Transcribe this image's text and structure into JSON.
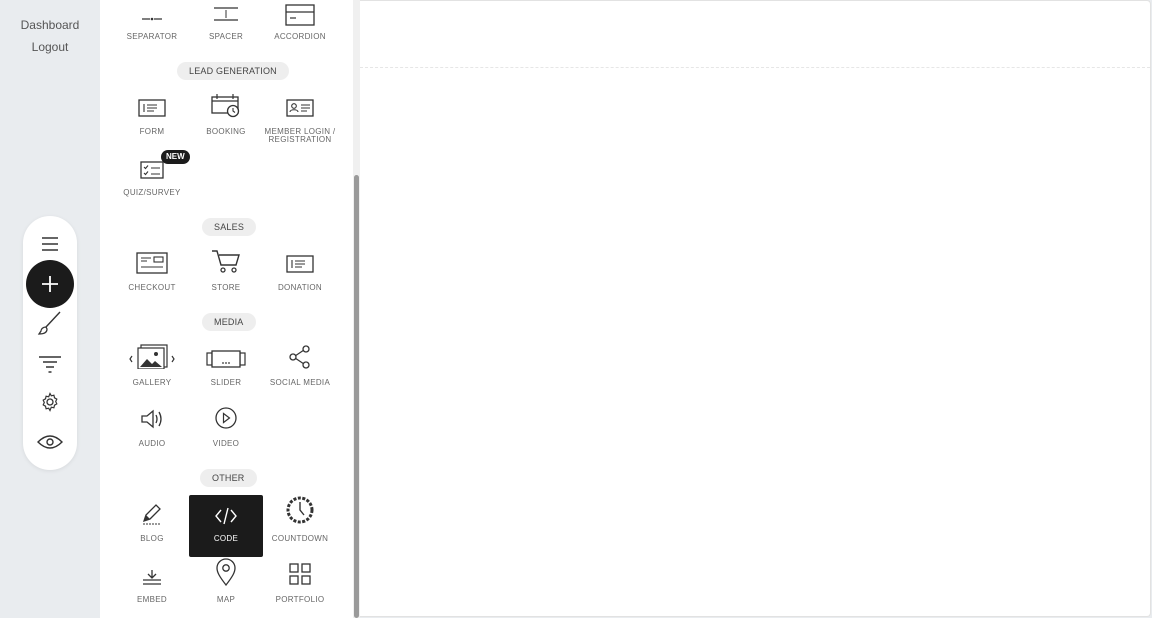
{
  "nav": {
    "dashboard": "Dashboard",
    "logout": "Logout"
  },
  "toolbar": {
    "items": [
      {
        "icon": "menu-icon"
      },
      {
        "icon": "plus-icon"
      },
      {
        "icon": "brush-icon"
      },
      {
        "icon": "filter-icon"
      },
      {
        "icon": "gear-icon"
      },
      {
        "icon": "eye-icon"
      }
    ]
  },
  "panel": {
    "top_row": [
      {
        "label": "SEPARATOR",
        "icon": "separator-icon"
      },
      {
        "label": "SPACER",
        "icon": "spacer-icon"
      },
      {
        "label": "ACCORDION",
        "icon": "accordion-icon"
      }
    ],
    "lead_generation": {
      "title": "LEAD GENERATION",
      "items": [
        {
          "label": "FORM",
          "icon": "form-icon"
        },
        {
          "label": "BOOKING",
          "icon": "booking-icon"
        },
        {
          "label": "MEMBER LOGIN /",
          "label2": "REGISTRATION",
          "icon": "member-login-icon"
        },
        {
          "label": "QUIZ/SURVEY",
          "icon": "quiz-survey-icon",
          "badge": "NEW"
        }
      ]
    },
    "sales": {
      "title": "SALES",
      "items": [
        {
          "label": "CHECKOUT",
          "icon": "checkout-icon"
        },
        {
          "label": "STORE",
          "icon": "cart-icon"
        },
        {
          "label": "DONATION",
          "icon": "donation-icon"
        }
      ]
    },
    "media": {
      "title": "MEDIA",
      "items": [
        {
          "label": "GALLERY",
          "icon": "gallery-icon"
        },
        {
          "label": "SLIDER",
          "icon": "slider-icon"
        },
        {
          "label": "SOCIAL MEDIA",
          "icon": "share-icon"
        },
        {
          "label": "AUDIO",
          "icon": "speaker-icon"
        },
        {
          "label": "VIDEO",
          "icon": "play-icon"
        }
      ]
    },
    "other": {
      "title": "OTHER",
      "items": [
        {
          "label": "BLOG",
          "icon": "pencil-icon"
        },
        {
          "label": "CODE",
          "icon": "code-icon",
          "selected": true
        },
        {
          "label": "COUNTDOWN",
          "icon": "countdown-icon"
        },
        {
          "label": "EMBED",
          "icon": "embed-icon"
        },
        {
          "label": "MAP",
          "icon": "map-pin-icon"
        },
        {
          "label": "PORTFOLIO",
          "icon": "portfolio-icon"
        }
      ]
    }
  },
  "colors": {
    "accent_dark": "#1b1b1b",
    "background": "#e9ecef",
    "panel": "#ffffff"
  }
}
